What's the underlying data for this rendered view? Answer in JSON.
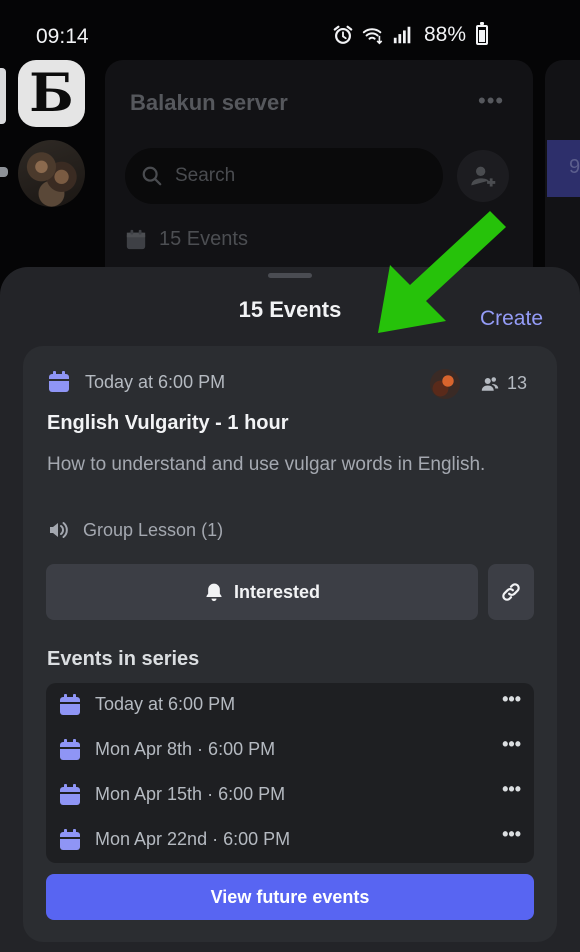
{
  "status_bar": {
    "time": "09:14",
    "battery_percent": "88%",
    "icons": [
      "alarm-icon",
      "wifi-calling-icon",
      "signal-icon",
      "battery-icon"
    ]
  },
  "background": {
    "server_letter": "Б",
    "server_name": "Balakun server",
    "more_label": "•••",
    "search_placeholder": "Search",
    "events_label": "15 Events",
    "peek_text": "9"
  },
  "sheet": {
    "title": "15 Events",
    "create_label": "Create",
    "event": {
      "time": "Today at 6:00 PM",
      "interested_count": "13",
      "title": "English Vulgarity - 1 hour",
      "description": "How to understand and use vulgar words in English.",
      "location": "Group Lesson (1)",
      "interested_button": "Interested",
      "series_heading": "Events in series",
      "series": [
        {
          "label": "Today at 6:00 PM",
          "more": "•••"
        },
        {
          "label": "Mon Apr 8th · 6:00 PM",
          "more": "•••"
        },
        {
          "label": "Mon Apr 15th · 6:00 PM",
          "more": "•••"
        },
        {
          "label": "Mon Apr 22nd · 6:00 PM",
          "more": "•••"
        }
      ],
      "view_future_button": "View future events"
    }
  },
  "colors": {
    "accent": "#5865f2",
    "link": "#949cf7",
    "calendar_icon": "#8f95f5",
    "annotation_arrow": "#26c20a"
  }
}
